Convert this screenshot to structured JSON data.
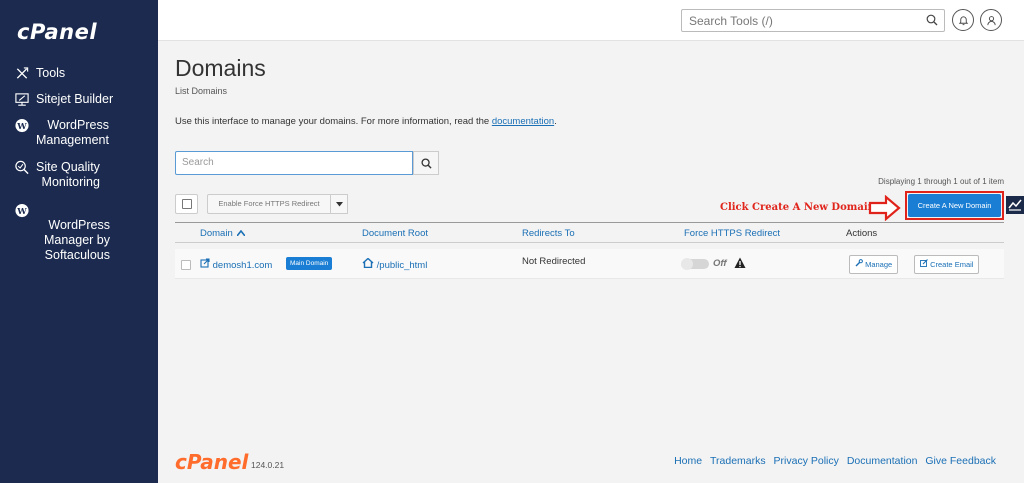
{
  "sidebar": {
    "logo": "cPanel",
    "items": [
      {
        "label": "Tools",
        "icon": "tools-icon"
      },
      {
        "label": "Sitejet Builder",
        "icon": "sitejet-icon"
      },
      {
        "label": "WordPress\nManagement",
        "icon": "wordpress-icon"
      },
      {
        "label": "Site Quality\nMonitoring",
        "icon": "site-quality-icon"
      },
      {
        "label": "WordPress\nManager by\nSoftaculous",
        "icon": "wordpress-icon"
      }
    ]
  },
  "header": {
    "search_placeholder": "Search Tools (/)"
  },
  "main": {
    "title": "Domains",
    "subtitle": "List Domains",
    "intro_text": "Use this interface to manage your domains. For more information, read the ",
    "intro_link": "documentation",
    "intro_end": ".",
    "search_placeholder": "Search",
    "displaying": "Displaying 1 through 1 out of 1 item",
    "force_https_button": "Enable Force HTTPS Redirect",
    "create_button": "Create A New Domain",
    "annotation": "Click Create A New Domain",
    "table": {
      "headers": [
        "Domain",
        "Document Root",
        "Redirects To",
        "Force HTTPS Redirect",
        "Actions"
      ],
      "rows": [
        {
          "domain": "demosh1.com",
          "badge": "Main Domain",
          "document_root": "/public_html",
          "redirects_to": "Not Redirected",
          "force_https": "Off",
          "actions": [
            "Manage",
            "Create Email"
          ]
        }
      ]
    }
  },
  "footer": {
    "logo": "cPanel",
    "version": "124.0.21",
    "links": [
      "Home",
      "Trademarks",
      "Privacy Policy",
      "Documentation",
      "Give Feedback"
    ]
  },
  "colors": {
    "sidebar_bg": "#1b2a4e",
    "accent_blue": "#1a7ed4",
    "annotation_red": "#e0241b",
    "brand_orange": "#ff6c2c"
  }
}
